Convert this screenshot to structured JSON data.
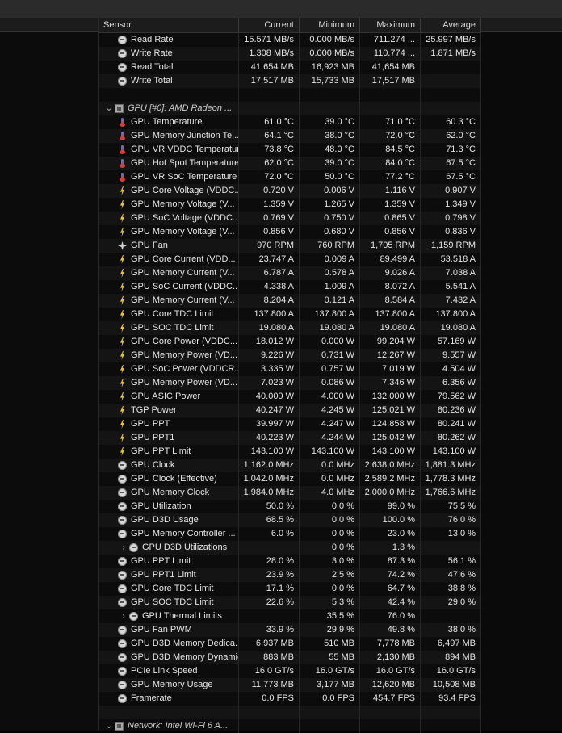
{
  "header": {
    "sensor": "Sensor",
    "current": "Current",
    "minimum": "Minimum",
    "maximum": "Maximum",
    "average": "Average"
  },
  "rows": [
    {
      "icon": "clock",
      "kind": "sensor",
      "name": "Read Rate",
      "cur": "15.571 MB/s",
      "min": "0.000 MB/s",
      "max": "711.274 ...",
      "avg": "25.997 MB/s"
    },
    {
      "icon": "clock",
      "kind": "sensor",
      "name": "Write Rate",
      "cur": "1.308 MB/s",
      "min": "0.000 MB/s",
      "max": "110.774 ...",
      "avg": "1.871 MB/s"
    },
    {
      "icon": "clock",
      "kind": "sensor",
      "name": "Read Total",
      "cur": "41,654 MB",
      "min": "16,923 MB",
      "max": "41,654 MB",
      "avg": ""
    },
    {
      "icon": "clock",
      "kind": "sensor",
      "name": "Write Total",
      "cur": "17,517 MB",
      "min": "15,733 MB",
      "max": "17,517 MB",
      "avg": ""
    },
    {
      "kind": "blank"
    },
    {
      "icon": "chip",
      "kind": "group",
      "toggle": "⌄",
      "name": "GPU [#0]: AMD Radeon ..."
    },
    {
      "icon": "temp",
      "kind": "sensor",
      "name": "GPU Temperature",
      "cur": "61.0 °C",
      "min": "39.0 °C",
      "max": "71.0 °C",
      "avg": "60.3 °C"
    },
    {
      "icon": "temp",
      "kind": "sensor",
      "name": "GPU Memory Junction Te...",
      "cur": "64.1 °C",
      "min": "38.0 °C",
      "max": "72.0 °C",
      "avg": "62.0 °C"
    },
    {
      "icon": "temp",
      "kind": "sensor",
      "name": "GPU VR VDDC Temperature",
      "cur": "73.8 °C",
      "min": "48.0 °C",
      "max": "84.5 °C",
      "avg": "71.3 °C"
    },
    {
      "icon": "temp",
      "kind": "sensor",
      "name": "GPU Hot Spot Temperature",
      "cur": "62.0 °C",
      "min": "39.0 °C",
      "max": "84.0 °C",
      "avg": "67.5 °C"
    },
    {
      "icon": "temp",
      "kind": "sensor",
      "name": "GPU VR SoC Temperature",
      "cur": "72.0 °C",
      "min": "50.0 °C",
      "max": "77.2 °C",
      "avg": "67.5 °C"
    },
    {
      "icon": "volt",
      "kind": "sensor",
      "name": "GPU Core Voltage (VDDC...",
      "cur": "0.720 V",
      "min": "0.006 V",
      "max": "1.116 V",
      "avg": "0.907 V"
    },
    {
      "icon": "volt",
      "kind": "sensor",
      "name": "GPU Memory Voltage (V...",
      "cur": "1.359 V",
      "min": "1.265 V",
      "max": "1.359 V",
      "avg": "1.349 V"
    },
    {
      "icon": "volt",
      "kind": "sensor",
      "name": "GPU SoC Voltage (VDDC...",
      "cur": "0.769 V",
      "min": "0.750 V",
      "max": "0.865 V",
      "avg": "0.798 V"
    },
    {
      "icon": "volt",
      "kind": "sensor",
      "name": "GPU Memory Voltage (V...",
      "cur": "0.856 V",
      "min": "0.680 V",
      "max": "0.856 V",
      "avg": "0.836 V"
    },
    {
      "icon": "fan",
      "kind": "sensor",
      "name": "GPU Fan",
      "cur": "970 RPM",
      "min": "760 RPM",
      "max": "1,705 RPM",
      "avg": "1,159 RPM"
    },
    {
      "icon": "volt",
      "kind": "sensor",
      "name": "GPU Core Current (VDD...",
      "cur": "23.747 A",
      "min": "0.009 A",
      "max": "89.499 A",
      "avg": "53.518 A"
    },
    {
      "icon": "volt",
      "kind": "sensor",
      "name": "GPU Memory Current (V...",
      "cur": "6.787 A",
      "min": "0.578 A",
      "max": "9.026 A",
      "avg": "7.038 A"
    },
    {
      "icon": "volt",
      "kind": "sensor",
      "name": "GPU SoC Current (VDDC...",
      "cur": "4.338 A",
      "min": "1.009 A",
      "max": "8.072 A",
      "avg": "5.541 A"
    },
    {
      "icon": "volt",
      "kind": "sensor",
      "name": "GPU Memory Current (V...",
      "cur": "8.204 A",
      "min": "0.121 A",
      "max": "8.584 A",
      "avg": "7.432 A"
    },
    {
      "icon": "volt",
      "kind": "sensor",
      "name": "GPU Core TDC Limit",
      "cur": "137.800 A",
      "min": "137.800 A",
      "max": "137.800 A",
      "avg": "137.800 A"
    },
    {
      "icon": "volt",
      "kind": "sensor",
      "name": "GPU SOC TDC Limit",
      "cur": "19.080 A",
      "min": "19.080 A",
      "max": "19.080 A",
      "avg": "19.080 A"
    },
    {
      "icon": "volt",
      "kind": "sensor",
      "name": "GPU Core Power (VDDC...",
      "cur": "18.012 W",
      "min": "0.000 W",
      "max": "99.204 W",
      "avg": "57.169 W"
    },
    {
      "icon": "volt",
      "kind": "sensor",
      "name": "GPU Memory Power (VD...",
      "cur": "9.226 W",
      "min": "0.731 W",
      "max": "12.267 W",
      "avg": "9.557 W"
    },
    {
      "icon": "volt",
      "kind": "sensor",
      "name": "GPU SoC Power (VDDCR...",
      "cur": "3.335 W",
      "min": "0.757 W",
      "max": "7.019 W",
      "avg": "4.504 W"
    },
    {
      "icon": "volt",
      "kind": "sensor",
      "name": "GPU Memory Power (VD...",
      "cur": "7.023 W",
      "min": "0.086 W",
      "max": "7.346 W",
      "avg": "6.356 W"
    },
    {
      "icon": "volt",
      "kind": "sensor",
      "name": "GPU ASIC Power",
      "cur": "40.000 W",
      "min": "4.000 W",
      "max": "132.000 W",
      "avg": "79.562 W"
    },
    {
      "icon": "volt",
      "kind": "sensor",
      "name": "TGP Power",
      "cur": "40.247 W",
      "min": "4.245 W",
      "max": "125.021 W",
      "avg": "80.236 W"
    },
    {
      "icon": "volt",
      "kind": "sensor",
      "name": "GPU PPT",
      "cur": "39.997 W",
      "min": "4.247 W",
      "max": "124.858 W",
      "avg": "80.241 W"
    },
    {
      "icon": "volt",
      "kind": "sensor",
      "name": "GPU PPT1",
      "cur": "40.223 W",
      "min": "4.244 W",
      "max": "125.042 W",
      "avg": "80.262 W"
    },
    {
      "icon": "volt",
      "kind": "sensor",
      "name": "GPU PPT Limit",
      "cur": "143.100 W",
      "min": "143.100 W",
      "max": "143.100 W",
      "avg": "143.100 W"
    },
    {
      "icon": "clock",
      "kind": "sensor",
      "name": "GPU Clock",
      "cur": "1,162.0 MHz",
      "min": "0.0 MHz",
      "max": "2,638.0 MHz",
      "avg": "1,881.3 MHz"
    },
    {
      "icon": "clock",
      "kind": "sensor",
      "name": "GPU Clock (Effective)",
      "cur": "1,042.0 MHz",
      "min": "0.0 MHz",
      "max": "2,589.2 MHz",
      "avg": "1,778.3 MHz"
    },
    {
      "icon": "clock",
      "kind": "sensor",
      "name": "GPU Memory Clock",
      "cur": "1,984.0 MHz",
      "min": "4.0 MHz",
      "max": "2,000.0 MHz",
      "avg": "1,766.6 MHz"
    },
    {
      "icon": "clock",
      "kind": "sensor",
      "name": "GPU Utilization",
      "cur": "50.0 %",
      "min": "0.0 %",
      "max": "99.0 %",
      "avg": "75.5 %"
    },
    {
      "icon": "clock",
      "kind": "sensor",
      "name": "GPU D3D Usage",
      "cur": "68.5 %",
      "min": "0.0 %",
      "max": "100.0 %",
      "avg": "76.0 %"
    },
    {
      "icon": "clock",
      "kind": "sensor",
      "name": "GPU Memory Controller ...",
      "cur": "6.0 %",
      "min": "0.0 %",
      "max": "23.0 %",
      "avg": "13.0 %"
    },
    {
      "icon": "clock",
      "kind": "subgroup",
      "toggle": "›",
      "name": "GPU D3D Utilizations",
      "cur": "",
      "min": "0.0 %",
      "max": "1.3 %",
      "avg": ""
    },
    {
      "icon": "clock",
      "kind": "sensor",
      "name": "GPU PPT Limit",
      "cur": "28.0 %",
      "min": "3.0 %",
      "max": "87.3 %",
      "avg": "56.1 %"
    },
    {
      "icon": "clock",
      "kind": "sensor",
      "name": "GPU PPT1 Limit",
      "cur": "23.9 %",
      "min": "2.5 %",
      "max": "74.2 %",
      "avg": "47.6 %"
    },
    {
      "icon": "clock",
      "kind": "sensor",
      "name": "GPU Core TDC Limit",
      "cur": "17.1 %",
      "min": "0.0 %",
      "max": "64.7 %",
      "avg": "38.8 %"
    },
    {
      "icon": "clock",
      "kind": "sensor",
      "name": "GPU SOC TDC Limit",
      "cur": "22.6 %",
      "min": "5.3 %",
      "max": "42.4 %",
      "avg": "29.0 %"
    },
    {
      "icon": "clock",
      "kind": "subgroup",
      "toggle": "›",
      "name": "GPU Thermal Limits",
      "cur": "",
      "min": "35.5 %",
      "max": "76.0 %",
      "avg": ""
    },
    {
      "icon": "clock",
      "kind": "sensor",
      "name": "GPU Fan PWM",
      "cur": "33.9 %",
      "min": "29.9 %",
      "max": "49.8 %",
      "avg": "38.0 %"
    },
    {
      "icon": "clock",
      "kind": "sensor",
      "name": "GPU D3D Memory Dedica...",
      "cur": "6,937 MB",
      "min": "510 MB",
      "max": "7,778 MB",
      "avg": "6,497 MB"
    },
    {
      "icon": "clock",
      "kind": "sensor",
      "name": "GPU D3D Memory Dynamic",
      "cur": "883 MB",
      "min": "55 MB",
      "max": "2,130 MB",
      "avg": "894 MB"
    },
    {
      "icon": "clock",
      "kind": "sensor",
      "name": "PCIe Link Speed",
      "cur": "16.0 GT/s",
      "min": "16.0 GT/s",
      "max": "16.0 GT/s",
      "avg": "16.0 GT/s"
    },
    {
      "icon": "clock",
      "kind": "sensor",
      "name": "GPU Memory Usage",
      "cur": "11,773 MB",
      "min": "3,177 MB",
      "max": "12,620 MB",
      "avg": "10,508 MB"
    },
    {
      "icon": "clock",
      "kind": "sensor",
      "name": "Framerate",
      "cur": "0.0 FPS",
      "min": "0.0 FPS",
      "max": "454.7 FPS",
      "avg": "93.4 FPS"
    },
    {
      "kind": "blank"
    },
    {
      "icon": "chip",
      "kind": "group",
      "toggle": "⌄",
      "name": "Network: Intel Wi-Fi 6 A..."
    }
  ]
}
